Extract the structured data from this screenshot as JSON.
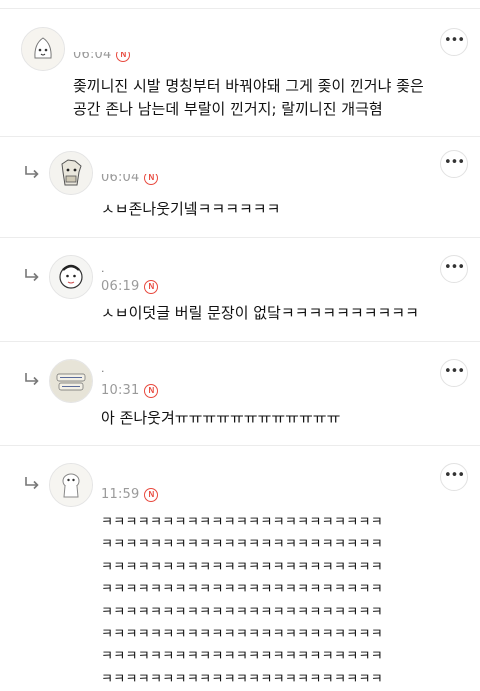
{
  "comments": [
    {
      "author": "",
      "time": "06:04",
      "badge": "N",
      "text": "좆끼니진 시발 명칭부터 바꿔야돼 그게 좆이 낀거냐 좆은 공간 존나 남는데 부랄이 낀거지; 랄끼니진 개극혐",
      "is_reply": false,
      "more_label": "•••"
    },
    {
      "author": "",
      "time": "06:04",
      "badge": "N",
      "text": "ㅅㅂ존나웃기넼ㅋㅋㅋㅋㅋㅋ",
      "is_reply": true,
      "more_label": "•••"
    },
    {
      "author": ".",
      "time": "06:19",
      "badge": "N",
      "text": "ㅅㅂ이덧글 버릴 문장이 없닼ㅋㅋㅋㅋㅋㅋㅋㅋㅋㅋ",
      "is_reply": true,
      "more_label": "•••"
    },
    {
      "author": ".",
      "time": "10:31",
      "badge": "N",
      "text": "아 존나웃겨ㅠㅠㅠㅠㅠㅠㅠㅠㅠㅠㅠㅠ",
      "is_reply": true,
      "more_label": "•••"
    },
    {
      "author": "",
      "time": "11:59",
      "badge": "N",
      "lines": [
        "ㅋㅋㅋㅋㅋㅋㅋㅋㅋㅋㅋㅋㅋㅋㅋㅋㅋㅋㅋㅋㅋㅋㅋ",
        "ㅋㅋㅋㅋㅋㅋㅋㅋㅋㅋㅋㅋㅋㅋㅋㅋㅋㅋㅋㅋㅋㅋㅋ",
        "ㅋㅋㅋㅋㅋㅋㅋㅋㅋㅋㅋㅋㅋㅋㅋㅋㅋㅋㅋㅋㅋㅋㅋ",
        "ㅋㅋㅋㅋㅋㅋㅋㅋㅋㅋㅋㅋㅋㅋㅋㅋㅋㅋㅋㅋㅋㅋㅋ",
        "ㅋㅋㅋㅋㅋㅋㅋㅋㅋㅋㅋㅋㅋㅋㅋㅋㅋㅋㅋㅋㅋㅋㅋ",
        "ㅋㅋㅋㅋㅋㅋㅋㅋㅋㅋㅋㅋㅋㅋㅋㅋㅋㅋㅋㅋㅋㅋㅋ",
        "ㅋㅋㅋㅋㅋㅋㅋㅋㅋㅋㅋㅋㅋㅋㅋㅋㅋㅋㅋㅋㅋㅋㅋ",
        "ㅋㅋㅋㅋㅋㅋㅋㅋㅋㅋㅋㅋㅋㅋㅋㅋㅋㅋㅋㅋㅋㅋㅋ"
      ],
      "is_reply": true,
      "more_label": "•••"
    }
  ],
  "icons": {
    "more": "more-options-icon",
    "reply": "reply-arrow-icon",
    "badge": "new-badge-icon"
  },
  "colors": {
    "badge": "#e8493e",
    "divider": "#ececec",
    "meta": "#9a9a9a"
  }
}
